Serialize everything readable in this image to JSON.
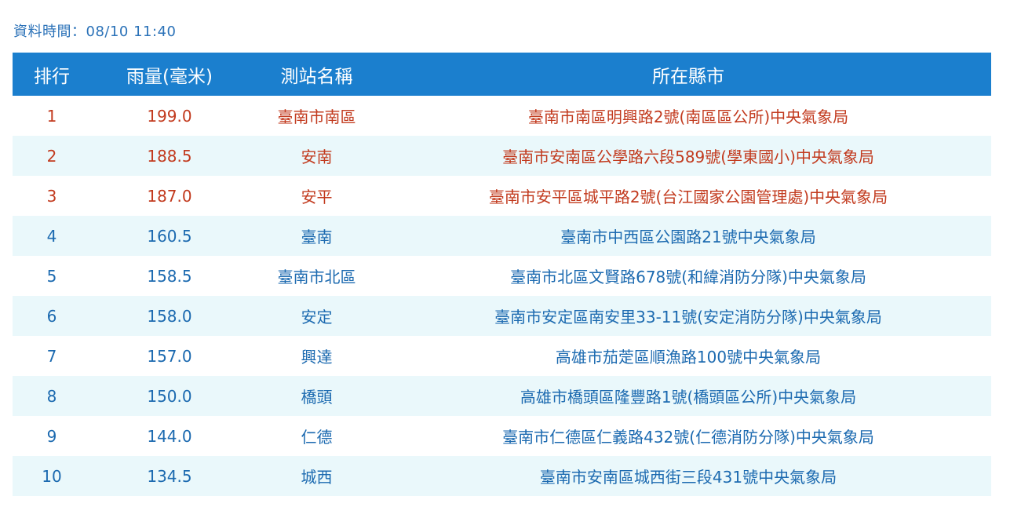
{
  "data_time": "資料時間：08/10 11:40",
  "table": {
    "headers": {
      "rank": "排行",
      "rainfall": "雨量(毫米)",
      "station": "測站名稱",
      "location": "所在縣市"
    },
    "rows": [
      {
        "rank": "1",
        "rainfall": "199.0",
        "station": "臺南市南區",
        "location": "臺南市南區明興路2號(南區區公所)中央氣象局"
      },
      {
        "rank": "2",
        "rainfall": "188.5",
        "station": "安南",
        "location": "臺南市安南區公學路六段589號(學東國小)中央氣象局"
      },
      {
        "rank": "3",
        "rainfall": "187.0",
        "station": "安平",
        "location": "臺南市安平區城平路2號(台江國家公園管理處)中央氣象局"
      },
      {
        "rank": "4",
        "rainfall": "160.5",
        "station": "臺南",
        "location": "臺南市中西區公園路21號中央氣象局"
      },
      {
        "rank": "5",
        "rainfall": "158.5",
        "station": "臺南市北區",
        "location": "臺南市北區文賢路678號(和緯消防分隊)中央氣象局"
      },
      {
        "rank": "6",
        "rainfall": "158.0",
        "station": "安定",
        "location": "臺南市安定區南安里33-11號(安定消防分隊)中央氣象局"
      },
      {
        "rank": "7",
        "rainfall": "157.0",
        "station": "興達",
        "location": "高雄市茄萣區順漁路100號中央氣象局"
      },
      {
        "rank": "8",
        "rainfall": "150.0",
        "station": "橋頭",
        "location": "高雄市橋頭區隆豐路1號(橋頭區公所)中央氣象局"
      },
      {
        "rank": "9",
        "rainfall": "144.0",
        "station": "仁德",
        "location": "臺南市仁德區仁義路432號(仁德消防分隊)中央氣象局"
      },
      {
        "rank": "10",
        "rainfall": "134.5",
        "station": "城西",
        "location": "臺南市安南區城西街三段431號中央氣象局"
      }
    ]
  },
  "colors": {
    "header_bg": "#1b7fce",
    "header_text": "#ffffff",
    "top3_text": "#c23a1e",
    "normal_text": "#1c6ab0",
    "alt_row_bg": "#eaf8fb"
  }
}
